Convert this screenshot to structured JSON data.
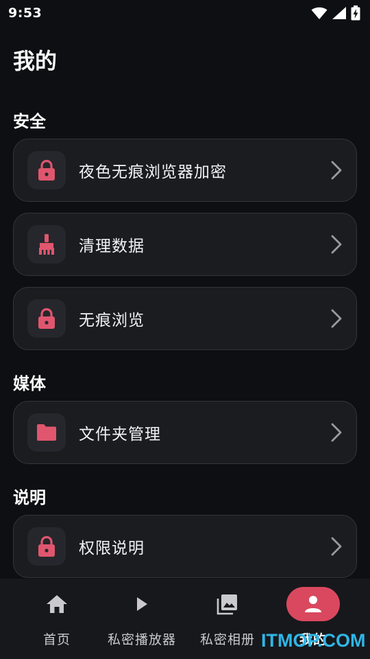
{
  "status_bar": {
    "time": "9:53",
    "icons": [
      "wifi-icon",
      "signal-icon",
      "battery-charging-icon"
    ]
  },
  "header": {
    "title": "我的"
  },
  "colors": {
    "background": "#0e0f12",
    "card": "#1b1c20",
    "accent": "#e0566e",
    "active_nav": "#d9485f",
    "watermark": "#2fb6e6"
  },
  "sections": [
    {
      "title": "安全",
      "items": [
        {
          "label": "夜色无痕浏览器加密",
          "icon": "lock-icon"
        },
        {
          "label": "清理数据",
          "icon": "broom-icon"
        },
        {
          "label": "无痕浏览",
          "icon": "lock-icon"
        }
      ]
    },
    {
      "title": "媒体",
      "items": [
        {
          "label": "文件夹管理",
          "icon": "folder-icon"
        }
      ]
    },
    {
      "title": "说明",
      "items": [
        {
          "label": "权限说明",
          "icon": "lock-icon"
        }
      ]
    }
  ],
  "bottom_nav": {
    "items": [
      {
        "label": "首页",
        "icon": "home-icon",
        "active": false
      },
      {
        "label": "私密播放器",
        "icon": "play-icon",
        "active": false
      },
      {
        "label": "私密相册",
        "icon": "gallery-icon",
        "active": false
      },
      {
        "label": "我的",
        "icon": "person-icon",
        "active": true
      }
    ]
  },
  "watermark": "ITMOP.COM"
}
